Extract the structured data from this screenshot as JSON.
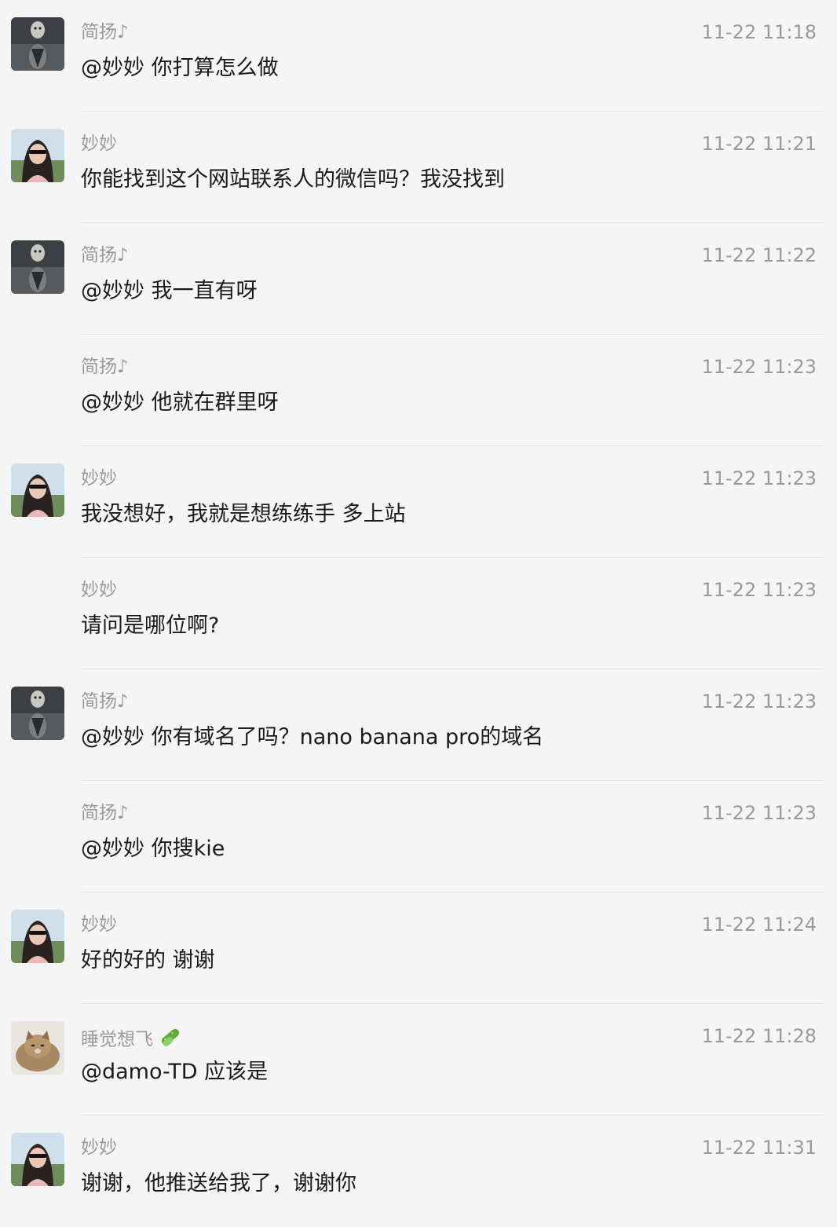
{
  "messages": [
    {
      "sender": "简扬♪",
      "time": "11-22 11:18",
      "text": "@妙妙 你打算怎么做",
      "avatar": "tiger-avatar",
      "show_avatar": true
    },
    {
      "sender": "妙妙",
      "time": "11-22 11:21",
      "text": "你能找到这个网站联系人的微信吗？我没找到",
      "avatar": "woman-avatar",
      "show_avatar": true
    },
    {
      "sender": "简扬♪",
      "time": "11-22 11:22",
      "text": "@妙妙 我一直有呀",
      "avatar": "tiger-avatar",
      "show_avatar": true
    },
    {
      "sender": "简扬♪",
      "time": "11-22 11:23",
      "text": "@妙妙 他就在群里呀",
      "avatar": "tiger-avatar",
      "show_avatar": false
    },
    {
      "sender": "妙妙",
      "time": "11-22 11:23",
      "text": "我没想好，我就是想练练手 多上站",
      "avatar": "woman-avatar",
      "show_avatar": true
    },
    {
      "sender": "妙妙",
      "time": "11-22 11:23",
      "text": "请问是哪位啊?",
      "avatar": "woman-avatar",
      "show_avatar": false
    },
    {
      "sender": "简扬♪",
      "time": "11-22 11:23",
      "text": "@妙妙 你有域名了吗？nano banana pro的域名",
      "avatar": "tiger-avatar",
      "show_avatar": true
    },
    {
      "sender": "简扬♪",
      "time": "11-22 11:23",
      "text": "@妙妙 你搜kie",
      "avatar": "tiger-avatar",
      "show_avatar": false
    },
    {
      "sender": "妙妙",
      "time": "11-22 11:24",
      "text": "好的好的 谢谢",
      "avatar": "woman-avatar",
      "show_avatar": true
    },
    {
      "sender": "睡觉想飞",
      "time": "11-22 11:28",
      "text": "@damo-TD 应该是",
      "avatar": "cat-avatar",
      "show_avatar": true,
      "sender_emoji": "cucumber-icon"
    },
    {
      "sender": "妙妙",
      "time": "11-22 11:31",
      "text": "谢谢，他推送给我了，谢谢你",
      "avatar": "woman-avatar",
      "show_avatar": true
    }
  ]
}
